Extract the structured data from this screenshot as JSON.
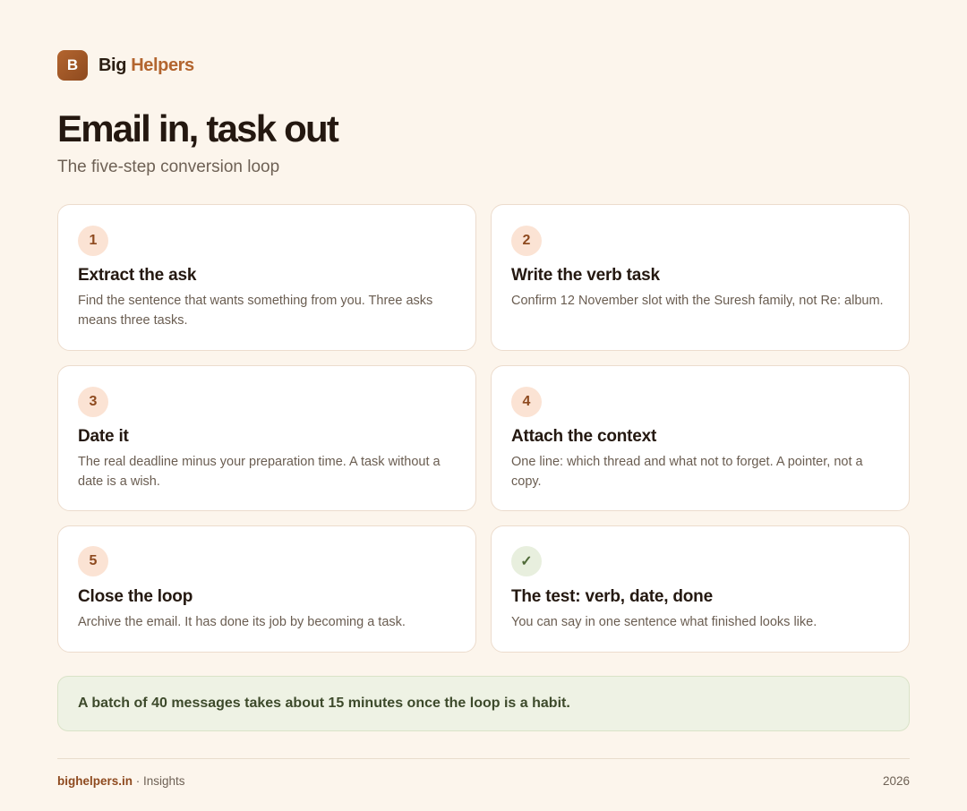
{
  "brand": {
    "logo_letter": "B",
    "name_first": "Big",
    "name_second": "Helpers"
  },
  "header": {
    "title": "Email in, task out",
    "subtitle": "The five-step conversion loop"
  },
  "cards": [
    {
      "badge": "1",
      "title": "Extract the ask",
      "text": "Find the sentence that wants something from you. Three asks means three tasks."
    },
    {
      "badge": "2",
      "title": "Write the verb task",
      "text": "Confirm 12 November slot with the Suresh family, not Re: album."
    },
    {
      "badge": "3",
      "title": "Date it",
      "text": "The real deadline minus your preparation time. A task without a date is a wish."
    },
    {
      "badge": "4",
      "title": "Attach the context",
      "text": "One line: which thread and what not to forget. A pointer, not a copy."
    },
    {
      "badge": "5",
      "title": "Close the loop",
      "text": "Archive the email. It has done its job by becoming a task."
    },
    {
      "badge": "✓",
      "title": "The test: verb, date, done",
      "text": "You can say in one sentence what finished looks like.",
      "icon": "checkmark-icon"
    }
  ],
  "callout": {
    "text": "A batch of 40 messages takes about 15 minutes once the loop is a habit."
  },
  "footer": {
    "domain": "bighelpers.in",
    "separator": " · ",
    "section": "Insights",
    "year": "2026"
  },
  "colors": {
    "background": "#fcf5ec",
    "accent": "#b3652f",
    "badge_bg": "#fbe3d4",
    "check_bg": "#e8efde",
    "callout_bg": "#eef2e4"
  }
}
